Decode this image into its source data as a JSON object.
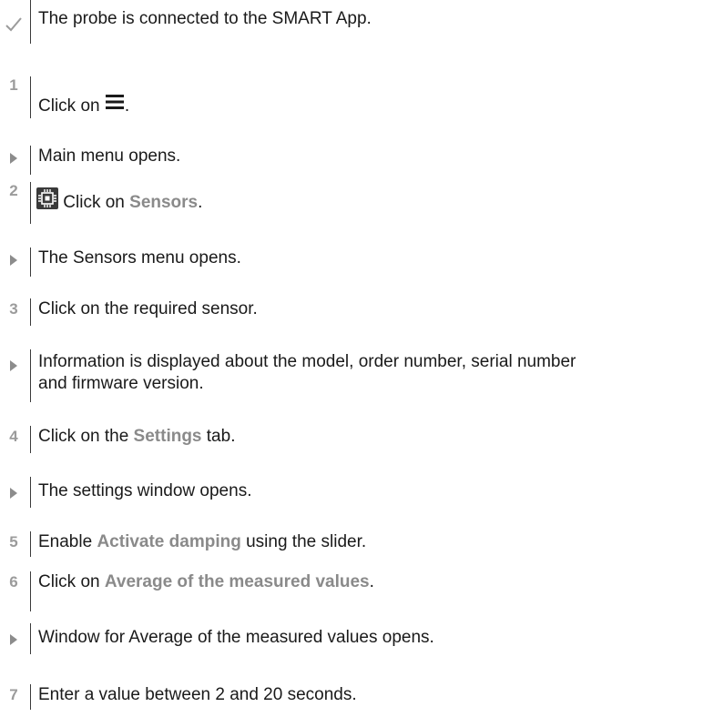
{
  "steps": {
    "pre": {
      "text": "The probe is connected to the SMART App."
    },
    "s1": {
      "num": "1",
      "before": "Click on ",
      "after": "."
    },
    "r1": {
      "text": "Main menu opens."
    },
    "s2": {
      "num": "2",
      "before": "Click on ",
      "bold": "Sensors",
      "after": "."
    },
    "r2": {
      "text": "The Sensors menu opens."
    },
    "s3": {
      "num": "3",
      "text": "Click on the required sensor."
    },
    "r3": {
      "line1": "Information is displayed about the model, order number, serial number",
      "line2": "and firmware version."
    },
    "s4": {
      "num": "4",
      "before": "Click on the ",
      "bold": "Settings",
      "after": " tab."
    },
    "r4": {
      "text": "The settings window opens."
    },
    "s5": {
      "num": "5",
      "before": "Enable ",
      "bold": "Activate damping",
      "after": " using the slider."
    },
    "s6": {
      "num": "6",
      "before": "Click on ",
      "bold": "Average of the measured values",
      "after": "."
    },
    "r6": {
      "text": "Window for Average of the measured values opens."
    },
    "s7": {
      "num": "7",
      "text": "Enter a value between 2 and 20 seconds."
    }
  },
  "icons": {
    "precondition": "check-icon",
    "result": "triangle-arrow-icon",
    "menu": "hamburger-menu-icon",
    "sensors": "chip-icon"
  },
  "colors": {
    "text": "#1a1a1a",
    "step_number": "#9b9b9b",
    "highlight": "#8a8a8a",
    "result_arrow": "#8c8c8c",
    "rule": "#3a3a3a"
  }
}
